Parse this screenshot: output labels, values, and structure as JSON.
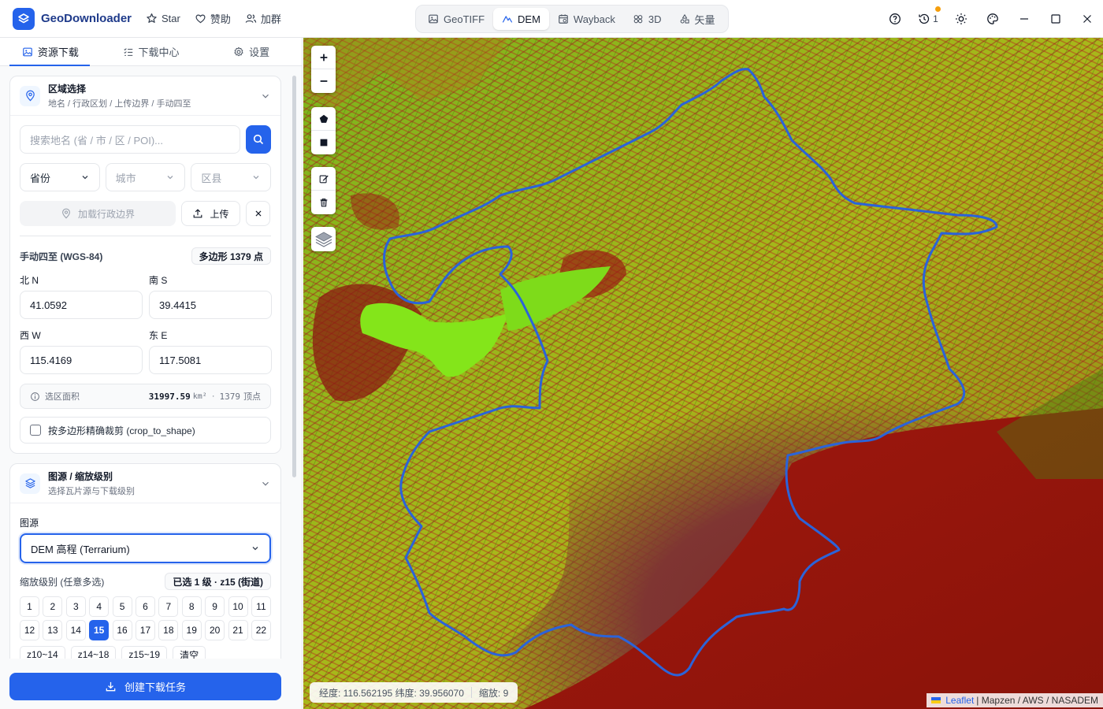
{
  "app": {
    "title": "GeoDownloader",
    "links": [
      {
        "label": "Star",
        "icon": "star-icon"
      },
      {
        "label": "赞助",
        "icon": "heart-icon"
      },
      {
        "label": "加群",
        "icon": "users-icon"
      }
    ],
    "brand_color": "#2563eb"
  },
  "mode_tabs": [
    {
      "label": "GeoTIFF",
      "icon": "image-icon",
      "active": false
    },
    {
      "label": "DEM",
      "icon": "mountain-icon",
      "active": true
    },
    {
      "label": "Wayback",
      "icon": "calendar-icon",
      "active": false
    },
    {
      "label": "3D",
      "icon": "cube-icon",
      "active": false
    },
    {
      "label": "矢量",
      "icon": "shapes-icon",
      "active": false
    }
  ],
  "window": {
    "history_count": "1"
  },
  "side_tabs": [
    {
      "label": "资源下载",
      "icon": "image-icon",
      "active": true
    },
    {
      "label": "下载中心",
      "icon": "list-icon",
      "active": false
    },
    {
      "label": "设置",
      "icon": "gear-icon",
      "active": false
    }
  ],
  "region": {
    "title": "区域选择",
    "subtitle": "地名 / 行政区划 / 上传边界 / 手动四至",
    "search_placeholder": "搜索地名 (省 / 市 / 区 / POI)...",
    "province": "省份",
    "city": "城市",
    "district": "区县",
    "load_boundary": "加载行政边界",
    "upload": "上传",
    "bbox_label": "手动四至 (WGS-84)",
    "polygon_badge": "多边形 1379 点",
    "north_label": "北 N",
    "north": "41.0592",
    "south_label": "南 S",
    "south": "39.4415",
    "west_label": "西 W",
    "west": "115.4169",
    "east_label": "东 E",
    "east": "117.5081",
    "area_label": "选区面积",
    "area_value": "31997.59",
    "area_unit": "km²",
    "vertex_count": "1379",
    "vertex_label": "顶点",
    "crop_label": "按多边形精确裁剪 (crop_to_shape)"
  },
  "source": {
    "title": "图源 / 缩放级别",
    "subtitle": "选择瓦片源与下载级别",
    "source_label": "图源",
    "source_value": "DEM 高程 (Terrarium)",
    "zoom_label": "缩放级别 (任意多选)",
    "zoom_badge": "已选 1 级 · z15 (街道)",
    "levels": [
      "1",
      "2",
      "3",
      "4",
      "5",
      "6",
      "7",
      "8",
      "9",
      "10",
      "11",
      "12",
      "13",
      "14",
      "15",
      "16",
      "17",
      "18",
      "19",
      "20",
      "21",
      "22"
    ],
    "selected_level": 15,
    "presets": [
      "z10~14",
      "z14~18",
      "z15~19",
      "清空"
    ]
  },
  "create_button": "创建下载任务",
  "map": {
    "coords": "经度: 116.562195 纬度: 39.956070",
    "zoom": "缩放: 9",
    "attribution_leaflet": "Leaflet",
    "attribution_rest": "| Mapzen / AWS / NASADEM",
    "boundary_color": "#2563eb",
    "terrain_colors": [
      "#7f1d1d",
      "#b91c1c",
      "#84cc16",
      "#65a30d",
      "#8b3a3a"
    ]
  }
}
